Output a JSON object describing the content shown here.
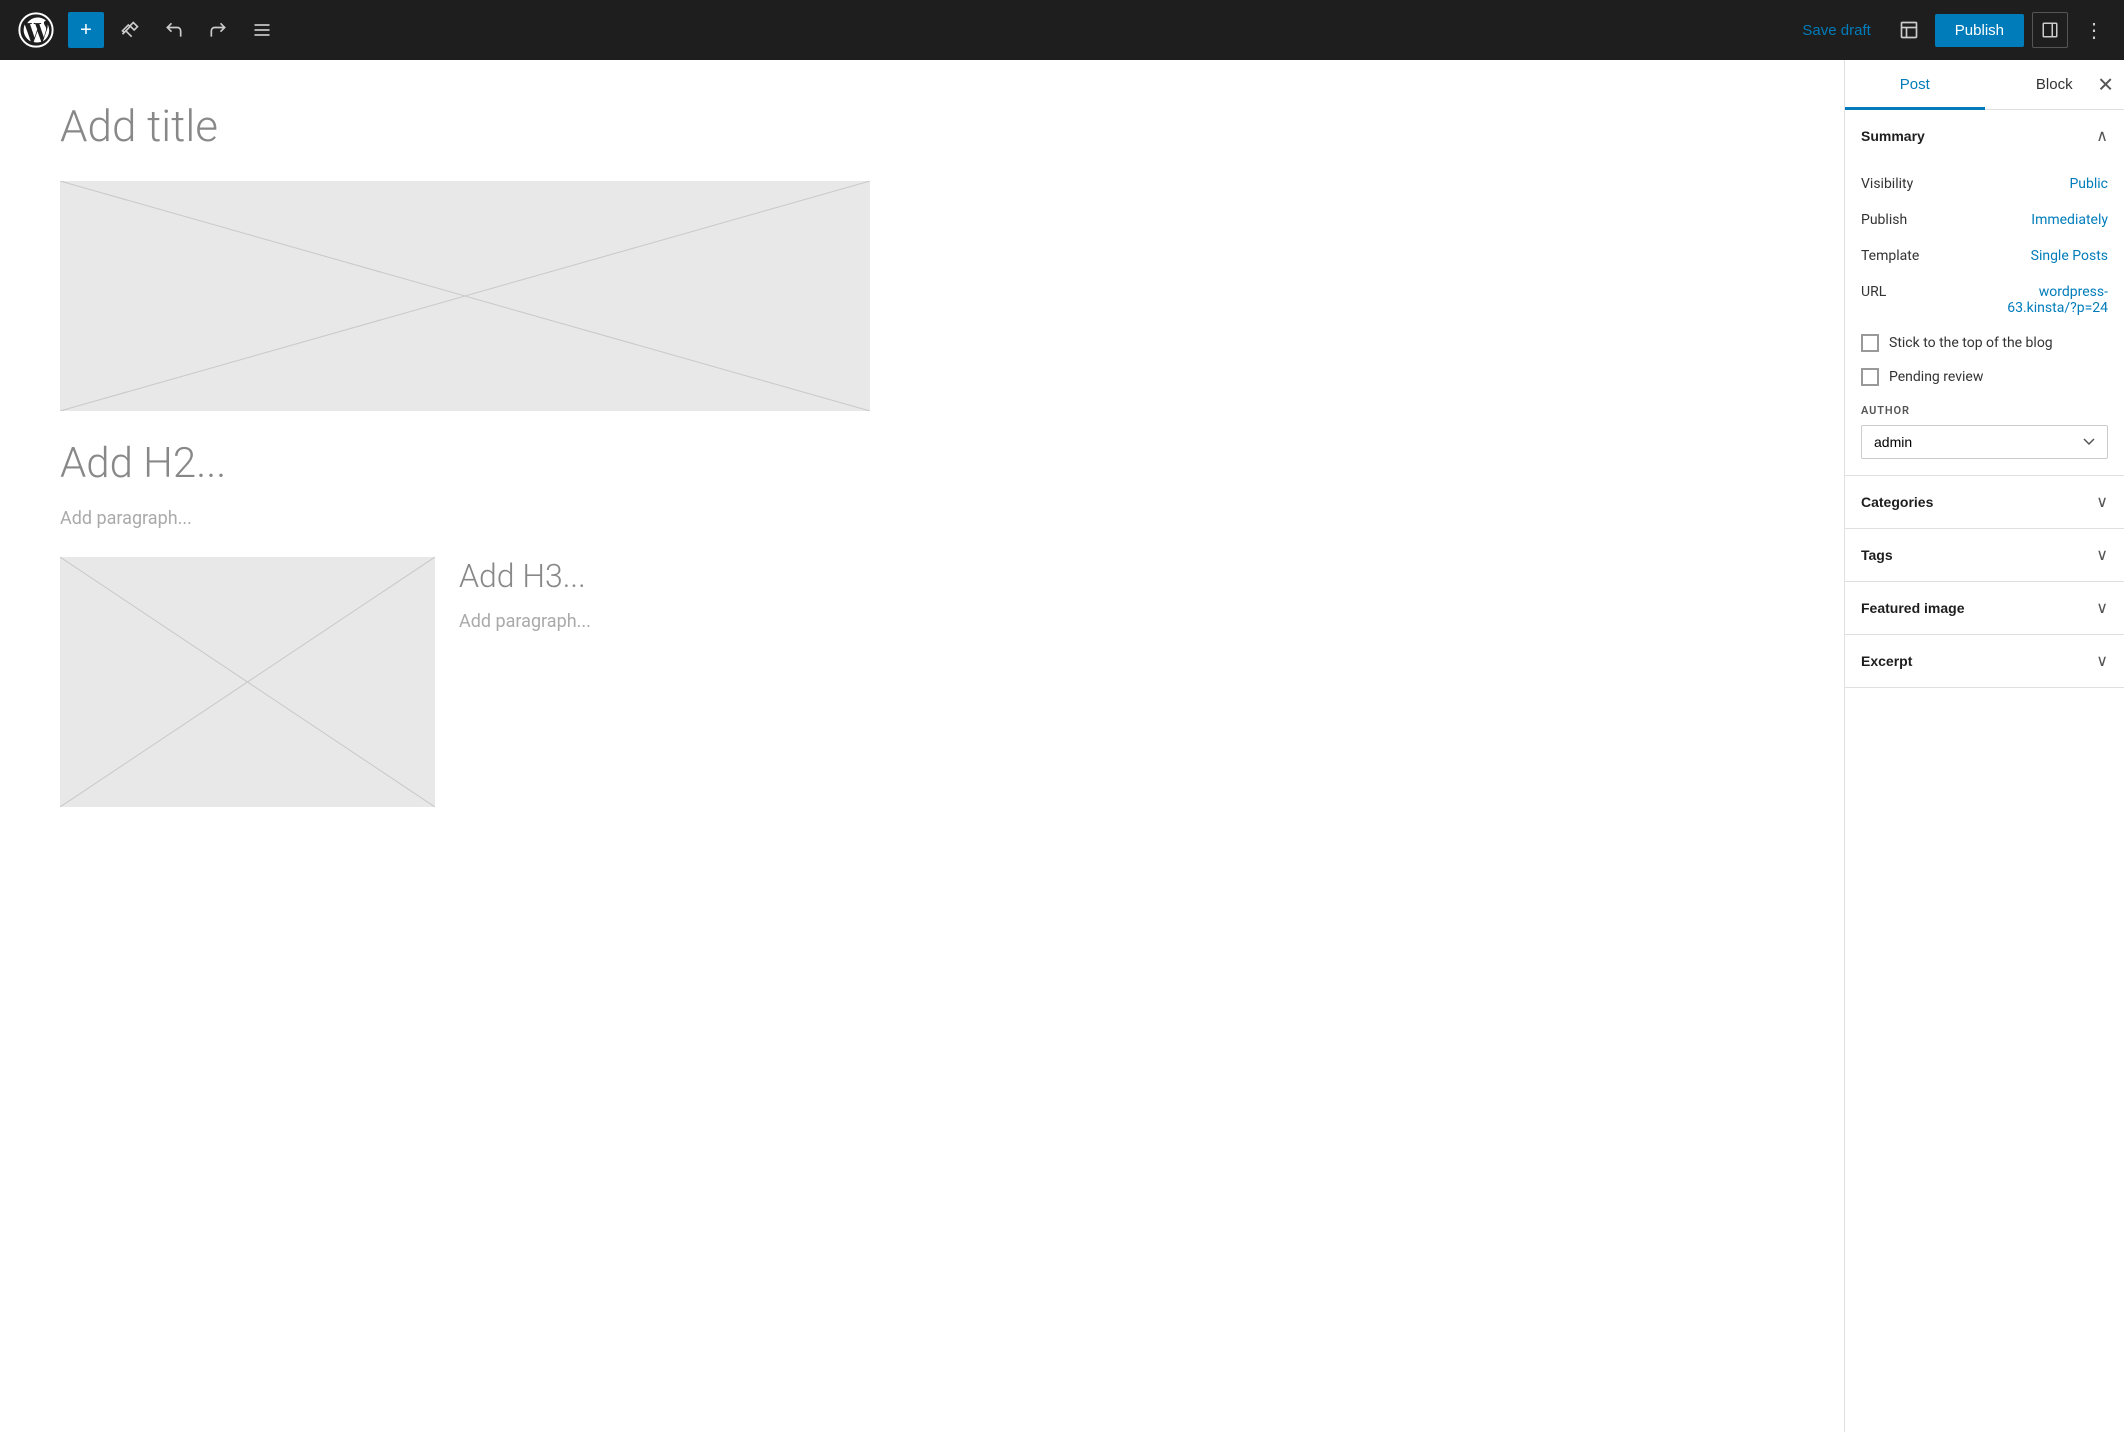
{
  "topbar": {
    "add_label": "+",
    "save_draft_label": "Save draft",
    "publish_label": "Publish"
  },
  "editor": {
    "title_placeholder": "Add title",
    "h2_placeholder": "Add H2...",
    "paragraph1_placeholder": "Add paragraph...",
    "h3_placeholder": "Add H3...",
    "paragraph2_placeholder": "Add paragraph..."
  },
  "sidebar": {
    "tab_post": "Post",
    "tab_block": "Block",
    "summary_title": "Summary",
    "visibility_label": "Visibility",
    "visibility_value": "Public",
    "publish_label": "Publish",
    "publish_value": "Immediately",
    "template_label": "Template",
    "template_value": "Single Posts",
    "url_label": "URL",
    "url_value_line1": "wordpress-",
    "url_value_line2": "63.kinsta/?p=24",
    "url_full": "wordpress-63.kinsta/?p=24",
    "stick_to_top_label": "Stick to the top of the blog",
    "pending_review_label": "Pending review",
    "author_label": "AUTHOR",
    "author_value": "admin",
    "categories_title": "Categories",
    "tags_title": "Tags",
    "featured_image_title": "Featured image",
    "excerpt_title": "Excerpt"
  }
}
